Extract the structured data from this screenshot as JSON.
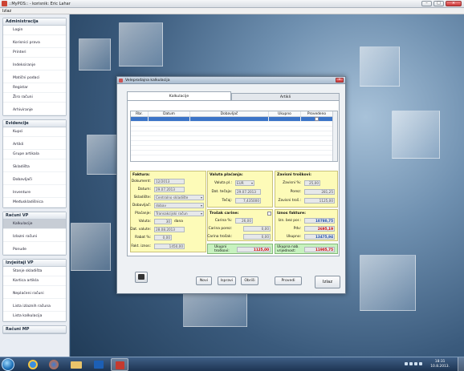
{
  "app": {
    "title": "::MyPOS:: - korisnik: Eric Lahar",
    "menu": "Izlaz"
  },
  "sidebar": {
    "sections": [
      {
        "title": "Administracija",
        "items": [
          {
            "label": "Login"
          },
          {
            "label": "Korisnici prava",
            "gap": true
          },
          {
            "label": "Printeri"
          },
          {
            "label": "Indeksiranje",
            "gap": true
          },
          {
            "label": "Matični podaci",
            "gap": true
          },
          {
            "label": "Registar"
          },
          {
            "label": "Žiro računi"
          },
          {
            "label": "Arhiviranje",
            "gap": true
          }
        ]
      },
      {
        "title": "Evidencije",
        "items": [
          {
            "label": "Kupci"
          },
          {
            "label": "Artikli",
            "gap": true
          },
          {
            "label": "Grupe artikala"
          },
          {
            "label": "Skladišta",
            "gap": true
          },
          {
            "label": "Dobavljači",
            "gap": true
          },
          {
            "label": "Inventure",
            "gap": true
          },
          {
            "label": "Međuskladišnica"
          }
        ]
      },
      {
        "title": "Računi VP",
        "items": [
          {
            "label": "Kalkulacije",
            "active": true
          },
          {
            "label": "Izlazni računi",
            "gap": true
          },
          {
            "label": "Ponude",
            "gap": true
          }
        ]
      },
      {
        "title": "Izvještaji VP",
        "items": [
          {
            "label": "Stanje skladišta"
          },
          {
            "label": "Kartica artikla"
          },
          {
            "label": "Neplaćeni računi",
            "gap": true
          },
          {
            "label": "Lista izlaznih računa",
            "gap": true
          },
          {
            "label": "Lista kalkulacija"
          }
        ]
      },
      {
        "title": "Računi MP",
        "items": []
      }
    ]
  },
  "dialog": {
    "title": "Veleprodajna kalkulacija",
    "tabs": [
      "Kalkulacije",
      "Artikli"
    ],
    "grid": {
      "columns": [
        "Rbr.",
        "Datum",
        "Dobavljač",
        "Ukupno",
        "Provedeno"
      ]
    },
    "faktura": {
      "title": "Faktura:",
      "dokument_label": "Dokument:",
      "dokument": "12/2013",
      "datum_label": "Datum:",
      "datum": "29.07.2013",
      "skladiste_label": "Skladište:",
      "skladiste": "Centralno skladište",
      "dobavljac_label": "Dobavljač:",
      "dobavljac": "dobav",
      "placanje_label": "Plaćanje:",
      "placanje": "Transakcijski račun",
      "valuta_label": "Valuta:",
      "valuta": "30",
      "valuta_unit": "dana",
      "dat_valute_label": "Dat. valute:",
      "dat_valute": "28.08.2013",
      "rabat_label": "Rabat %:",
      "rabat": "0,00",
      "fakt_iznos_label": "Fakt. iznos:",
      "fakt_iznos": "1450,00"
    },
    "valuta_placanja": {
      "title": "Valuta plaćanja:",
      "valuta_pl_label": "Valuta pl.:",
      "valuta_pl": "EUR",
      "dat_tecaja_label": "Dat. tečaja:",
      "dat_tecaja": "29.07.2013",
      "tecaj_label": "Tečaj:",
      "tecaj": "7,435000"
    },
    "trosak_carine": {
      "title": "Trošak carine:",
      "carina_pct_label": "Carina %:",
      "carina_pct": "26,00",
      "carina_porez_label": "Carina porez:",
      "carina_porez": "0,00",
      "carina_trosak_label": "Carina trošak:",
      "carina_trosak": "0,00"
    },
    "zavisni_troskovi": {
      "title": "Zavisni troškovi:",
      "zavisni_pct_label": "Zavisni %:",
      "zavisni_pct": "25,00",
      "porez_label": "Porez:",
      "porez": "281,25",
      "zavisni_tros_label": "Zavisni troš.:",
      "zavisni_tros": "1125,00"
    },
    "iznos_fakture": {
      "title": "Iznos fakture:",
      "iz_bez_por_label": "Izn. bez por.:",
      "iz_bez_por": "10780,75",
      "pdv_label": "Pdv:",
      "pdv": "2695,19",
      "ukupno_label": "Ukupno:",
      "ukupno": "13475,94"
    },
    "ukupni_troskovi": {
      "label1": "Ukupni",
      "label2": "troškovi:",
      "value": "1125,00"
    },
    "ukupna_nab": {
      "label1": "Ukupna nab.",
      "label2": "vrijednost:",
      "value": "11905,75"
    },
    "buttons": {
      "novi": "Novi",
      "ispravi": "Ispravi",
      "obrisi": "Obriši",
      "provedi": "Provedi",
      "izlaz": "Izlaz"
    }
  },
  "taskbar": {
    "time": "18:31",
    "date": "10.8.2013."
  }
}
